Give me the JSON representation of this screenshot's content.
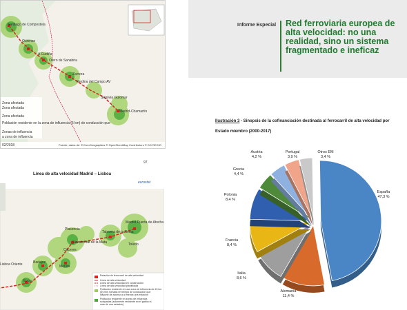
{
  "header": {
    "kicker": "Informe Especial",
    "title": "Red ferroviaria europea de alta velocidad: no una realidad, sino un sistema fragmentado e ineficaz"
  },
  "map_top": {
    "cities": [
      "Santiago de Compostela",
      "Ourense",
      "A Gudiña",
      "Otero de Sanabria",
      "Zamora",
      "Medina del Campo AV",
      "Segovia Guiomar",
      "Madrid-Chamartín"
    ],
    "legend": [
      "Zona afectada",
      "Zona afectada",
      "Zona afectada",
      "Población residente en la zona de influencia (5 km) de conducción que",
      "Zonas de influencia",
      "a zona de influencia"
    ],
    "footer_left": "02/2018",
    "footer_right": "Fuente: datos de: © EuroGeographics © OpenStreetMap Contributors © DG REGIO"
  },
  "page_number": "97",
  "map_bottom": {
    "title": "Línea de alta velocidad Madrid – Lisboa",
    "brand": "eurostat",
    "cities": [
      "Madrid Puerta de Atocha",
      "Talavera de la Reina",
      "Plasencia",
      "Navalmoral de la Mata",
      "Toledo",
      "Cáceres",
      "Mérida",
      "Badajoz",
      "Évora",
      "Lisboa Oriente"
    ],
    "legend": [
      "Estación de ferrocarril de alta velocidad",
      "Línea de alta velocidad",
      "Línea de alta velocidad en construcción",
      "Línea de alta velocidad planificada",
      "Población residente en una zona de influencia de 15 km",
      "(5) min) tomada en tiempo de conducción que",
      "dispone de acceso a al menos una estación",
      "Población residente en zonas de influencia",
      "solapadas (solamente residente en el gráfico a",
      "más de una estación)"
    ]
  },
  "illustration": {
    "number_label": "Ilustración 3",
    "title": " - Sinopsis de la cofinanciación destinada al ferrocarril de alta velocidad por",
    "subtitle": "Estado miembro (2000-2017)"
  },
  "chart_data": {
    "type": "pie",
    "title": "Sinopsis de la cofinanciación destinada al ferrocarril de alta velocidad por Estado miembro (2000-2017)",
    "slices": [
      {
        "label": "España",
        "value_text": "47,3 %",
        "value": 47.3,
        "color": "#4a86c5"
      },
      {
        "label": "Alemania",
        "value_text": "11,4 %",
        "value": 11.4,
        "color": "#d86a2b"
      },
      {
        "label": "Italia",
        "value_text": "8,6 %",
        "value": 8.6,
        "color": "#9e9e9e"
      },
      {
        "label": "Francia",
        "value_text": "8,4 %",
        "value": 8.4,
        "color": "#e8b716"
      },
      {
        "label": "Polonia",
        "value_text": "8,4 %",
        "value": 8.4,
        "color": "#2f5fae"
      },
      {
        "label": "Grecia",
        "value_text": "4,4 %",
        "value": 4.4,
        "color": "#4f8a3a"
      },
      {
        "label": "Austria",
        "value_text": "4,2 %",
        "value": 4.2,
        "color": "#8fb1e0"
      },
      {
        "label": "Portugal",
        "value_text": "3,9 %",
        "value": 3.9,
        "color": "#f0a48a"
      },
      {
        "label": "Otros EM",
        "value_text": "3,4 %",
        "value": 3.4,
        "color": "#c9c9c9"
      }
    ]
  }
}
